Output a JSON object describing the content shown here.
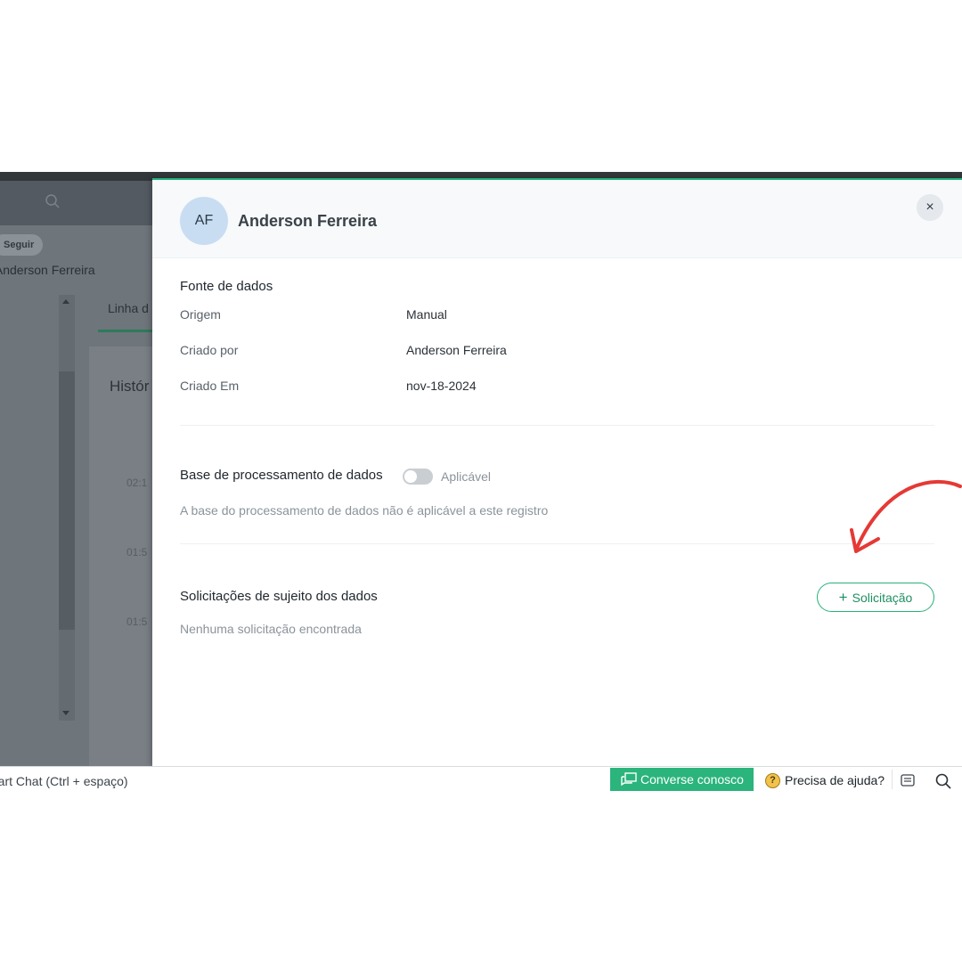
{
  "background": {
    "follow_label": "Seguir",
    "contact_name": "Anderson Ferreira",
    "tab_label": "Linha d",
    "section_label": "Histór",
    "times": [
      "02:1",
      "01:5",
      "01:5"
    ]
  },
  "panel": {
    "avatar_initials": "AF",
    "title": "Anderson Ferreira",
    "close_label": "×",
    "data_source": {
      "heading": "Fonte de dados",
      "rows": [
        {
          "label": "Origem",
          "value": "Manual"
        },
        {
          "label": "Criado por",
          "value": "Anderson Ferreira"
        },
        {
          "label": "Criado Em",
          "value": "nov-18-2024"
        }
      ]
    },
    "processing_basis": {
      "heading": "Base de processamento de dados",
      "toggle_label": "Aplicável",
      "toggle_on": false,
      "message": "A base do processamento de dados não é aplicável a este registro"
    },
    "subject_requests": {
      "heading": "Solicitações de sujeito dos dados",
      "add_button_label": "Solicitação",
      "empty_message": "Nenhuma solicitação encontrada"
    }
  },
  "bottombar": {
    "chat_hint": "mart Chat (Ctrl + espaço)",
    "talk_button": "Converse conosco",
    "help_icon_glyph": "?",
    "help_label": "Precisa de ajuda?"
  },
  "colors": {
    "accent": "#27b07a",
    "annotation": "#e53935",
    "avatar_bg": "#c8ddf2"
  }
}
